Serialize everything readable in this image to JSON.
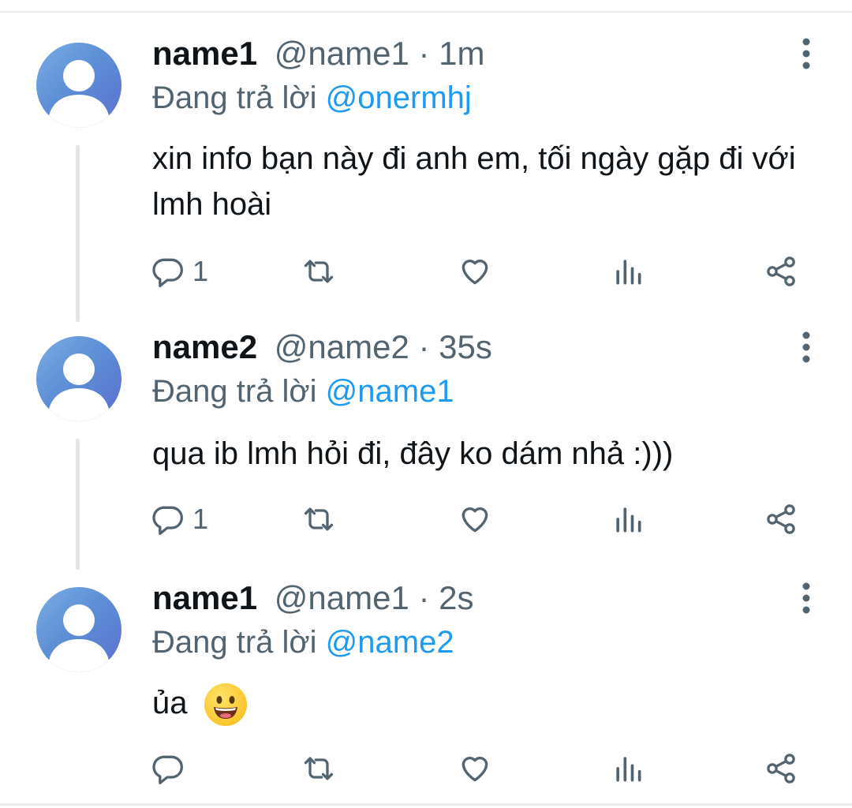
{
  "tweets": [
    {
      "display_name": "name1",
      "handle": "@name1",
      "separator": " · ",
      "time": "1m",
      "replying_prefix": "Đang trả lời ",
      "replying_to": "@onermhj",
      "text": "xin info bạn này đi anh em, tối ngày gặp đi với lmh hoài",
      "reply_count": "1"
    },
    {
      "display_name": "name2",
      "handle": "@name2",
      "separator": " · ",
      "time": "35s",
      "replying_prefix": "Đang trả lời ",
      "replying_to": "@name1",
      "text": "qua ib lmh hỏi đi, đây ko dám nhả :)))",
      "reply_count": "1"
    },
    {
      "display_name": "name1",
      "handle": "@name1",
      "separator": " · ",
      "time": "2s",
      "replying_prefix": "Đang trả lời ",
      "replying_to": "@name2",
      "text": "ủa",
      "emoji": "grinning-face-emoji",
      "reply_count": ""
    }
  ],
  "icons": {
    "reply": "reply-icon",
    "retweet": "retweet-icon",
    "like": "heart-icon",
    "views": "views-icon",
    "share": "share-icon",
    "more": "more-icon"
  },
  "colors": {
    "mention": "#1d9bf0",
    "secondary_text": "#536471",
    "primary_text": "#0f1419",
    "divider": "#e9ecee"
  }
}
